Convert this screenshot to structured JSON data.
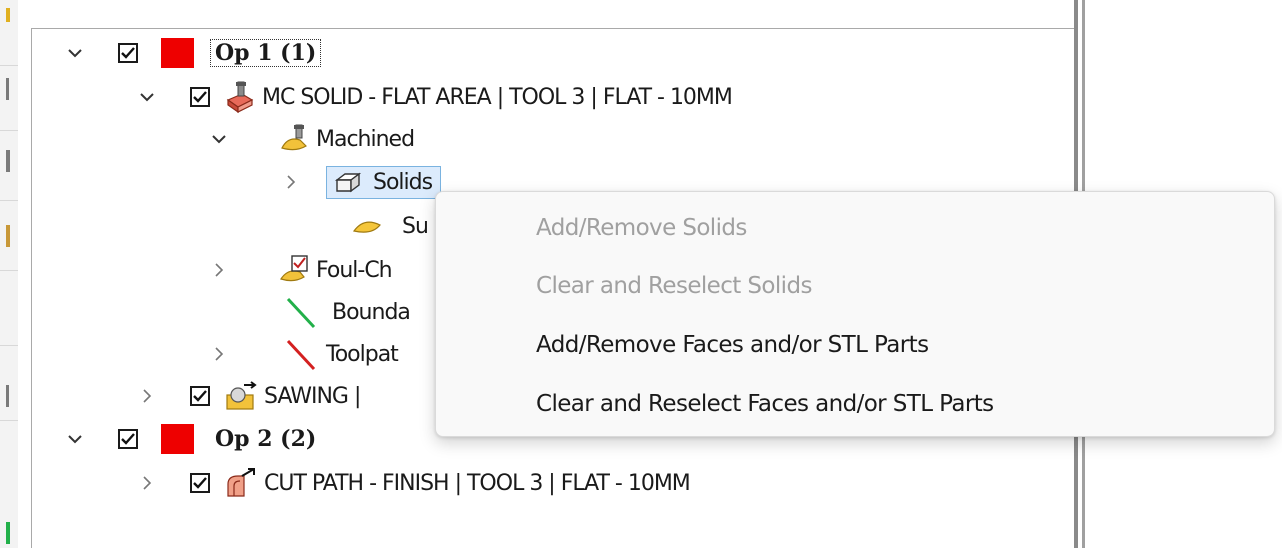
{
  "tree": {
    "op1_label": "Op 1 (1)",
    "mc_solid_label": "MC SOLID - FLAT AREA | TOOL 3 | FLAT - 10MM",
    "machined_label": "Machined",
    "solids_label": "Solids",
    "surfaces_label": "Su",
    "foul_check_label": "Foul-Ch",
    "boundary_label": "Bounda",
    "toolpath_label": "Toolpat",
    "sawing_label": "SAWING |",
    "op2_label": "Op 2 (2)",
    "cut_path_label": "CUT PATH - FINISH | TOOL 3 | FLAT - 10MM"
  },
  "context_menu": {
    "items": [
      {
        "label": "Add/Remove Solids",
        "enabled": false
      },
      {
        "label": "Clear and Reselect Solids",
        "enabled": false
      },
      {
        "label": "Add/Remove Faces and/or STL Parts",
        "enabled": true
      },
      {
        "label": "Clear and Reselect Faces and/or STL Parts",
        "enabled": true
      }
    ]
  },
  "colors": {
    "op_color": "#ee0000",
    "selection_fill": "#dcebfc",
    "selection_border": "#7ab3e0",
    "boundary_line": "#22b04a",
    "toolpath_line": "#d42020",
    "disabled_text": "#a0a0a0"
  },
  "icons": {
    "op_marker": "red-square",
    "mc_solid": "solid-operation-icon",
    "machined": "machined-geometry-icon",
    "solids": "solid-box-icon",
    "surfaces": "surface-icon",
    "foul_check": "foul-check-icon",
    "boundary": "boundary-line-icon",
    "toolpath": "toolpath-line-icon",
    "sawing": "sawing-operation-icon",
    "cut_path": "cut-path-operation-icon"
  }
}
